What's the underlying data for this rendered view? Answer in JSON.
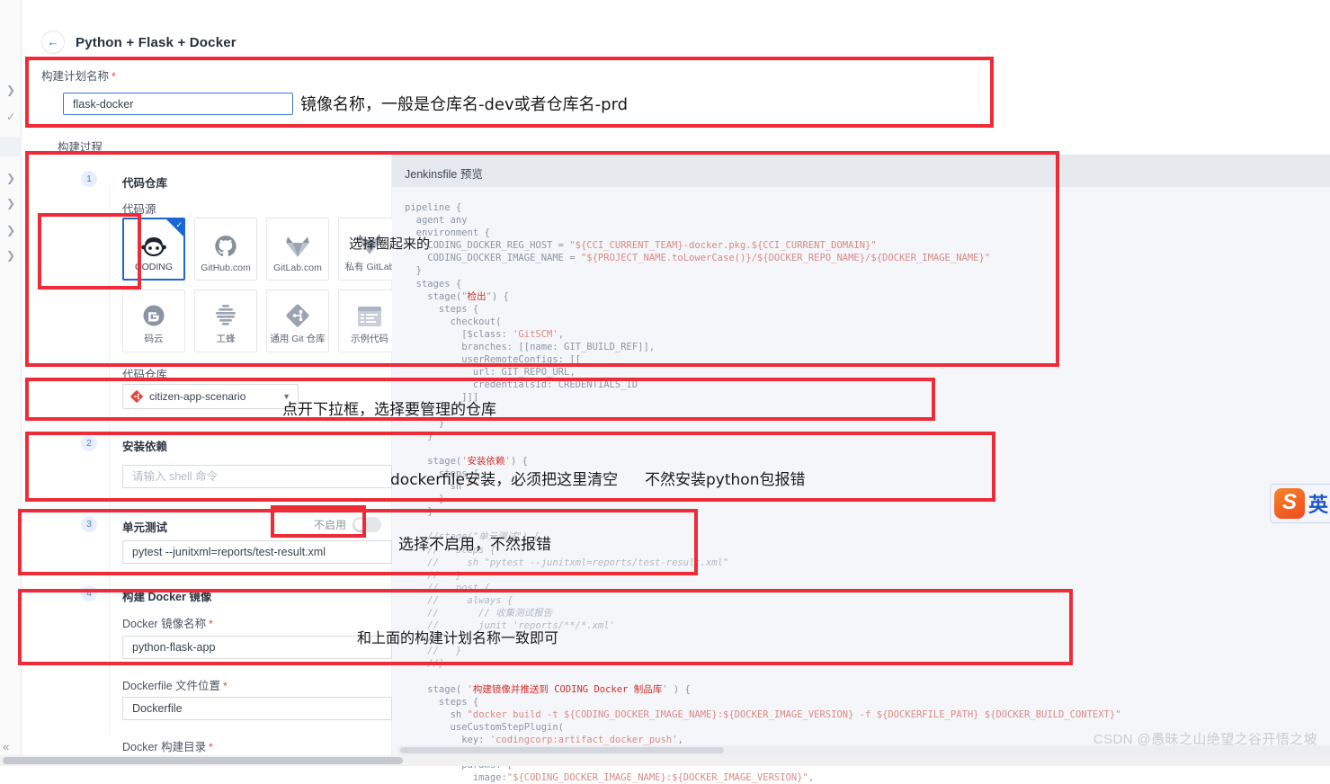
{
  "rail": {
    "items": [
      "chevron-right",
      "check",
      "selected-row",
      "chevron-right",
      "chevron-right",
      "chevron-right",
      "chevron-right"
    ],
    "collapse_glyph": "«"
  },
  "header": {
    "back_glyph": "←",
    "title": "Python + Flask + Docker"
  },
  "plan": {
    "label": "构建计划名称",
    "required_mark": "*",
    "value": "flask-docker"
  },
  "process": {
    "label": "构建过程"
  },
  "steps": [
    {
      "num": "1",
      "title": "代码仓库"
    },
    {
      "num": "2",
      "title": "安装依赖"
    },
    {
      "num": "3",
      "title": "单元测试"
    },
    {
      "num": "4",
      "title": "构建 Docker 镜像"
    }
  ],
  "code_source": {
    "label": "代码源",
    "items": [
      {
        "caption": "CODING",
        "icon": "coding-logo-icon",
        "selected": true
      },
      {
        "caption": "GitHub.com",
        "icon": "github-logo-icon",
        "selected": false
      },
      {
        "caption": "GitLab.com",
        "icon": "gitlab-logo-icon",
        "selected": false
      },
      {
        "caption": "私有 GitLab",
        "icon": "gitlab-logo-icon",
        "selected": false
      },
      {
        "caption": "码云",
        "icon": "gitee-logo-icon",
        "selected": false
      },
      {
        "caption": "工蜂",
        "icon": "tencent-git-icon",
        "selected": false
      },
      {
        "caption": "通用 Git 仓库",
        "icon": "generic-git-icon",
        "selected": false
      },
      {
        "caption": "示例代码",
        "icon": "sample-code-icon",
        "selected": false
      }
    ]
  },
  "repo": {
    "label": "代码仓库",
    "value": "citizen-app-scenario",
    "icon": "git-repo-icon",
    "caret": "▼"
  },
  "deps": {
    "placeholder": "请输入 shell 命令",
    "value": ""
  },
  "unit_test": {
    "toggle_label": "不启用",
    "toggle_on": false,
    "value": "pytest --junitxml=reports/test-result.xml"
  },
  "docker": {
    "image_name_label": "Docker 镜像名称",
    "image_name_value": "python-flask-app",
    "dockerfile_label": "Dockerfile 文件位置",
    "dockerfile_value": "Dockerfile",
    "context_label": "Docker 构建目录",
    "required_mark": "*"
  },
  "preview": {
    "title": "Jenkinsfile 预览",
    "code": "pipeline {\n  agent any\n  environment {\n    CODING_DOCKER_REG_HOST = \"${CCI_CURRENT_TEAM}-docker.pkg.${CCI_CURRENT_DOMAIN}\"\n    CODING_DOCKER_IMAGE_NAME = \"${PROJECT_NAME.toLowerCase()}/${DOCKER_REPO_NAME}/${DOCKER_IMAGE_NAME}\"\n  }\n  stages {\n    stage(\"检出\") {\n      steps {\n        checkout(\n          [$class: 'GitSCM',\n          branches: [[name: GIT_BUILD_REF]],\n          userRemoteConfigs: [[\n            url: GIT_REPO_URL,\n            credentialsId: CREDENTIALS_ID\n          ]]]\n        )\n      }\n    }\n\n    stage('安装依赖') {\n      steps {\n        sh \"\"\n      }\n    }\n\n    //stage(\"单元测试\") {\n    //   steps {\n    //     sh \"pytest --junitxml=reports/test-result.xml\"\n    //   }\n    //   post {\n    //     always {\n    //       // 收集测试报告\n    //       junit 'reports/**/*.xml'\n    //     }\n    //   }\n    //}\n\n    stage( '构建镜像并推送到 CODING Docker 制品库' ) {\n      steps {\n        sh \"docker build -t ${CODING_DOCKER_IMAGE_NAME}:${DOCKER_IMAGE_VERSION} -f ${DOCKERFILE_PATH} ${DOCKER_BUILD_CONTEXT}\"\n        useCustomStepPlugin(\n          key: 'codingcorp:artifact_docker_push',\n          version: 'latest',\n          params: [\n            image:\"${CODING_DOCKER_IMAGE_NAME}:${DOCKER_IMAGE_VERSION}\","
  },
  "annotations": [
    {
      "text": "镜像名称，一般是仓库名-dev或者仓库名-prd",
      "size": 18
    },
    {
      "text": "选择圈起来的",
      "size": 15
    },
    {
      "text": "点开下拉框，选择要管理的仓库",
      "size": 17
    },
    {
      "text": "dockerfile安装，必须把这里清空",
      "size": 17
    },
    {
      "text": "不然安装python包报错",
      "size": 17
    },
    {
      "text": "选择不启用，不然报错",
      "size": 17
    },
    {
      "text": "和上面的构建计划名称一致即可",
      "size": 16
    }
  ],
  "ime": {
    "logo_letter": "S",
    "label": "英"
  },
  "watermark": "CSDN @愚昧之山绝望之谷开悟之坡",
  "colors": {
    "accent": "#1966d6",
    "annotation_red": "#ef2b37",
    "required_star": "#e8432f",
    "code_gray": "#8d96a3"
  }
}
